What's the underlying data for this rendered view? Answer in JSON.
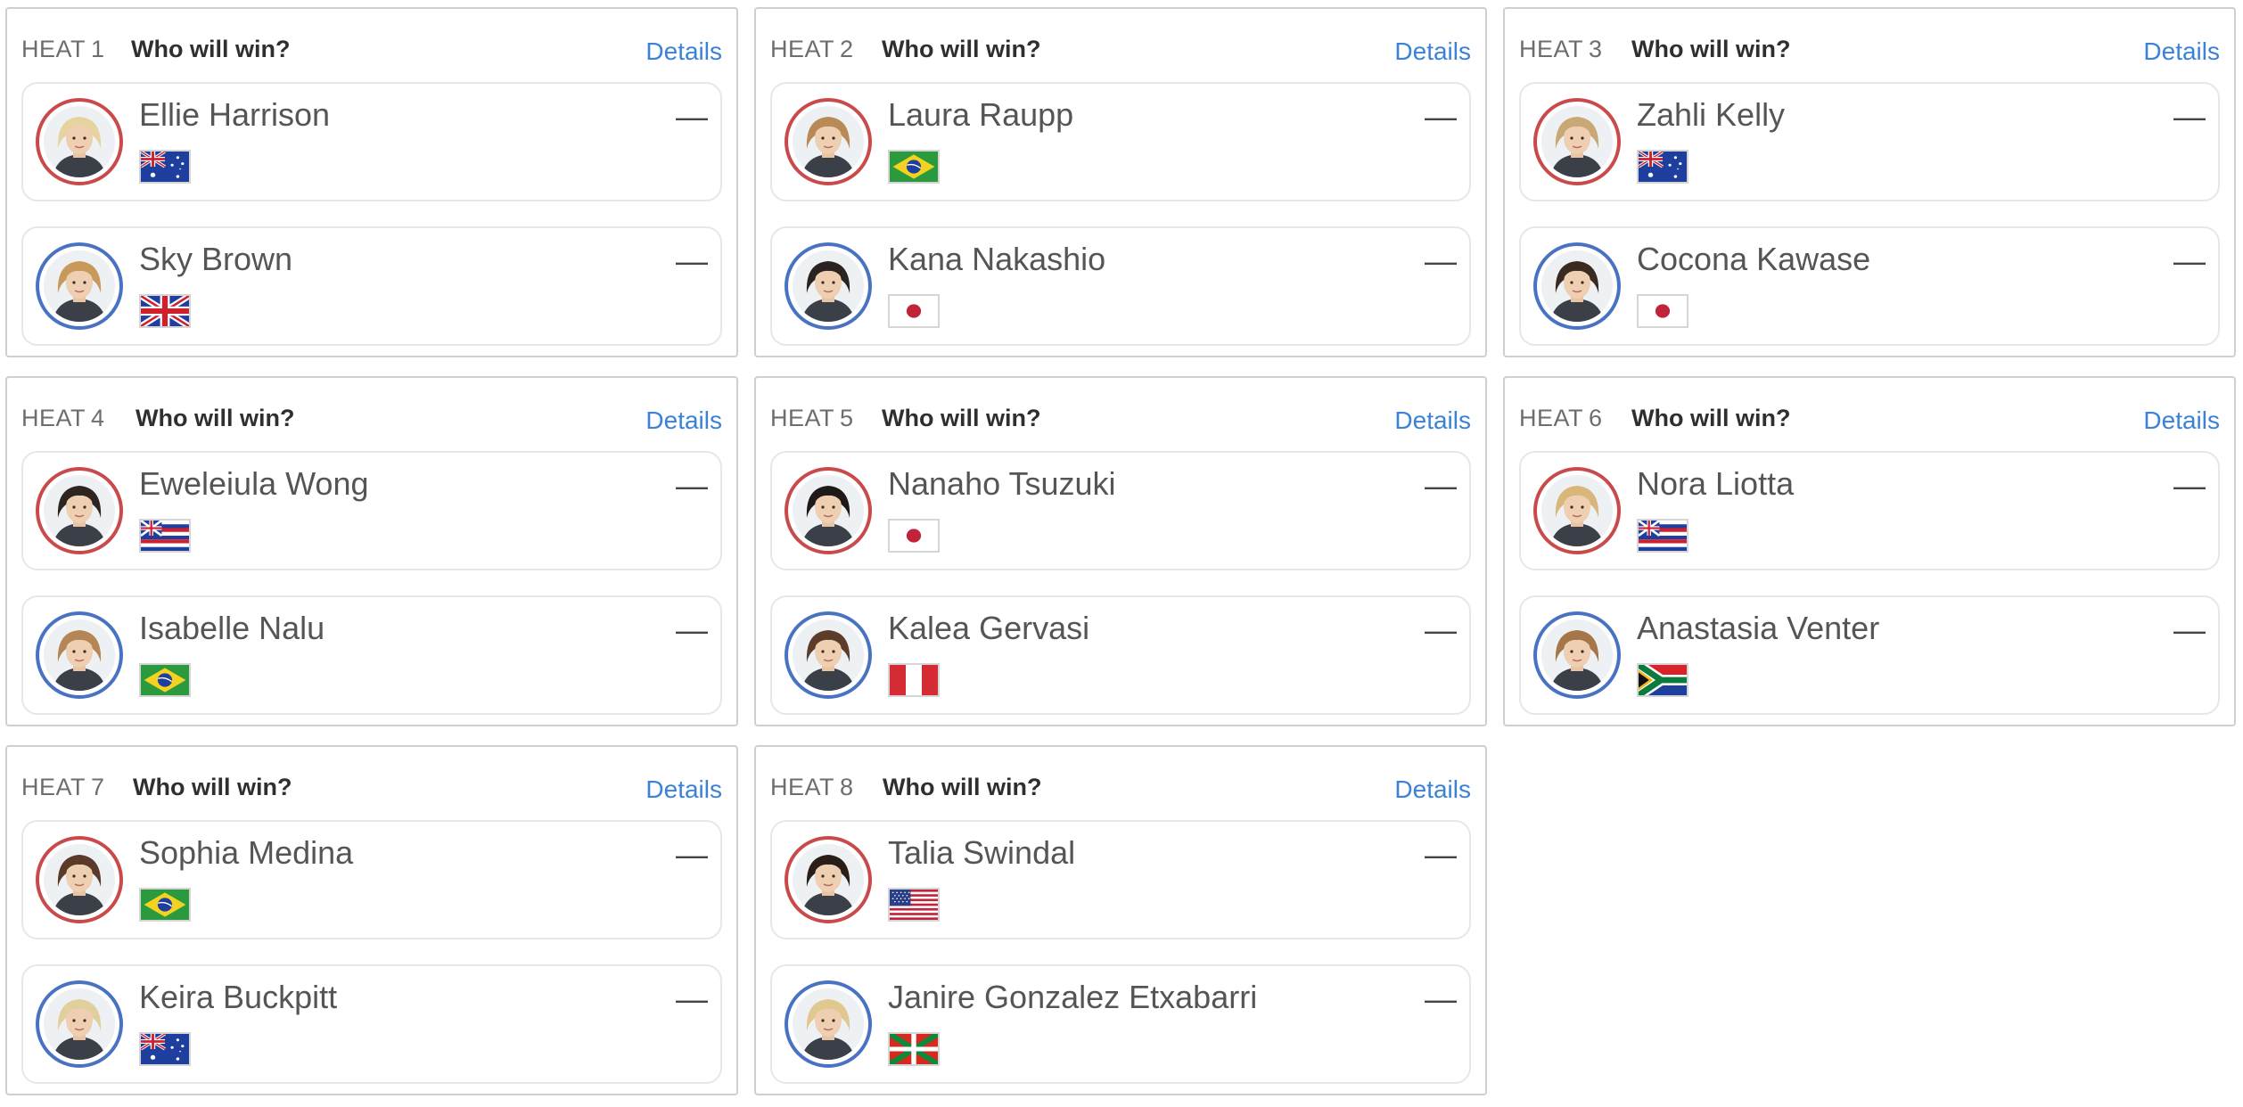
{
  "heat_label": "HEAT",
  "question": "Who will win?",
  "details_label": "Details",
  "colors": {
    "link": "#3b82d6",
    "competitor_1_ring": "#c94a4a",
    "competitor_2_ring": "#4a72c2"
  },
  "heats": [
    {
      "number": "1",
      "competitors": [
        {
          "name": "Ellie Harrison",
          "flag": "australia",
          "score": "—",
          "hair": "#e6d3a0"
        },
        {
          "name": "Sky Brown",
          "flag": "united-kingdom",
          "score": "—",
          "hair": "#c79a5b"
        }
      ]
    },
    {
      "number": "2",
      "competitors": [
        {
          "name": "Laura Raupp",
          "flag": "brazil",
          "score": "—",
          "hair": "#b98a55"
        },
        {
          "name": "Kana Nakashio",
          "flag": "japan",
          "score": "—",
          "hair": "#2b2320"
        }
      ]
    },
    {
      "number": "3",
      "competitors": [
        {
          "name": "Zahli Kelly",
          "flag": "australia",
          "score": "—",
          "hair": "#c8a874"
        },
        {
          "name": "Cocona Kawase",
          "flag": "japan",
          "score": "—",
          "hair": "#3a2a20"
        }
      ]
    },
    {
      "number": "4",
      "competitors": [
        {
          "name": "Eweleiula Wong",
          "flag": "hawaii",
          "score": "—",
          "hair": "#2e2420"
        },
        {
          "name": "Isabelle Nalu",
          "flag": "brazil",
          "score": "—",
          "hair": "#b58655"
        }
      ]
    },
    {
      "number": "5",
      "competitors": [
        {
          "name": "Nanaho Tsuzuki",
          "flag": "japan",
          "score": "—",
          "hair": "#1f1a18"
        },
        {
          "name": "Kalea Gervasi",
          "flag": "peru",
          "score": "—",
          "hair": "#5b3d2a"
        }
      ]
    },
    {
      "number": "6",
      "competitors": [
        {
          "name": "Nora Liotta",
          "flag": "hawaii",
          "score": "—",
          "hair": "#d9b67a"
        },
        {
          "name": "Anastasia Venter",
          "flag": "south-africa",
          "score": "—",
          "hair": "#a47648"
        }
      ]
    },
    {
      "number": "7",
      "competitors": [
        {
          "name": "Sophia Medina",
          "flag": "brazil",
          "score": "—",
          "hair": "#5a3a28"
        },
        {
          "name": "Keira Buckpitt",
          "flag": "australia",
          "score": "—",
          "hair": "#e2cf9e"
        }
      ]
    },
    {
      "number": "8",
      "competitors": [
        {
          "name": "Talia Swindal",
          "flag": "united-states",
          "score": "—",
          "hair": "#2a1e18"
        },
        {
          "name": "Janire Gonzalez Etxabarri",
          "flag": "basque-country",
          "score": "—",
          "hair": "#e0c890"
        }
      ]
    }
  ]
}
